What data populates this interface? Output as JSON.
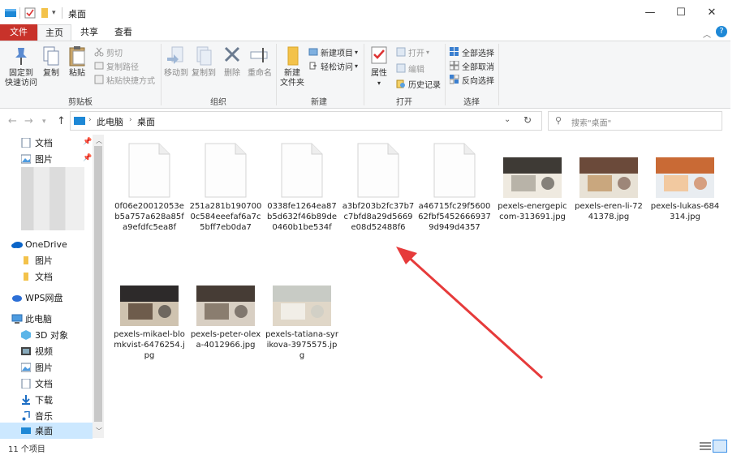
{
  "window": {
    "title": "桌面",
    "minimize": "—",
    "maximize": "☐",
    "close": "✕"
  },
  "tabs": {
    "file": "文件",
    "home": "主页",
    "share": "共享",
    "view": "查看"
  },
  "ribbon": {
    "clipboard": {
      "label": "剪贴板",
      "pin": "固定到\n快速访问",
      "copy": "复制",
      "paste": "粘贴",
      "cut": "剪切",
      "copy_path": "复制路径",
      "paste_shortcut": "粘贴快捷方式"
    },
    "organize": {
      "label": "组织",
      "move_to": "移动到",
      "copy_to": "复制到",
      "delete": "删除",
      "rename": "重命名"
    },
    "new": {
      "label": "新建",
      "new_folder": "新建\n文件夹",
      "new_item": "新建项目",
      "easy_access": "轻松访问"
    },
    "open": {
      "label": "打开",
      "properties": "属性",
      "open": "打开",
      "edit": "编辑",
      "history": "历史记录"
    },
    "select": {
      "label": "选择",
      "select_all": "全部选择",
      "select_none": "全部取消",
      "invert": "反向选择"
    }
  },
  "address": {
    "crumb_pc": "此电脑",
    "crumb_desktop": "桌面",
    "search_placeholder": "搜索\"桌面\""
  },
  "nav": {
    "quick": [
      {
        "label": "文档"
      },
      {
        "label": "图片"
      }
    ],
    "onedrive": {
      "label": "OneDrive",
      "items": [
        {
          "label": "图片"
        },
        {
          "label": "文档"
        }
      ]
    },
    "wps": {
      "label": "WPS网盘"
    },
    "pc": {
      "label": "此电脑",
      "items": [
        {
          "label": "3D 对象"
        },
        {
          "label": "视频"
        },
        {
          "label": "图片"
        },
        {
          "label": "文档"
        },
        {
          "label": "下载"
        },
        {
          "label": "音乐"
        },
        {
          "label": "桌面"
        }
      ]
    }
  },
  "files": [
    {
      "name": "0f06e20012053eb5a757a628a85fa9efdfc5ea8f",
      "type": "doc"
    },
    {
      "name": "251a281b1907000c584eeefaf6a7c5bff7eb0da7",
      "type": "doc"
    },
    {
      "name": "0338fe1264ea87b5d632f46b89de0460b1be534f",
      "type": "doc"
    },
    {
      "name": "a3bf203b2fc37b7c7bfd8a29d5669e08d52488f6",
      "type": "doc"
    },
    {
      "name": "a46715fc29f560062fbf54526669379d949d4357",
      "type": "doc"
    },
    {
      "name": "pexels-energepiccom-313691.jpg",
      "type": "img"
    },
    {
      "name": "pexels-eren-li-7241378.jpg",
      "type": "img"
    },
    {
      "name": "pexels-lukas-684314.jpg",
      "type": "img"
    },
    {
      "name": "pexels-mikael-blomkvist-6476254.jpg",
      "type": "img"
    },
    {
      "name": "pexels-peter-olexa-4012966.jpg",
      "type": "img"
    },
    {
      "name": "pexels-tatiana-syrikova-3975575.jpg",
      "type": "img"
    }
  ],
  "status": {
    "count": "11 个项目"
  },
  "colors": {
    "accent": "#0078d7",
    "file_tab": "#c8322a",
    "arrow": "#e63b3b"
  }
}
